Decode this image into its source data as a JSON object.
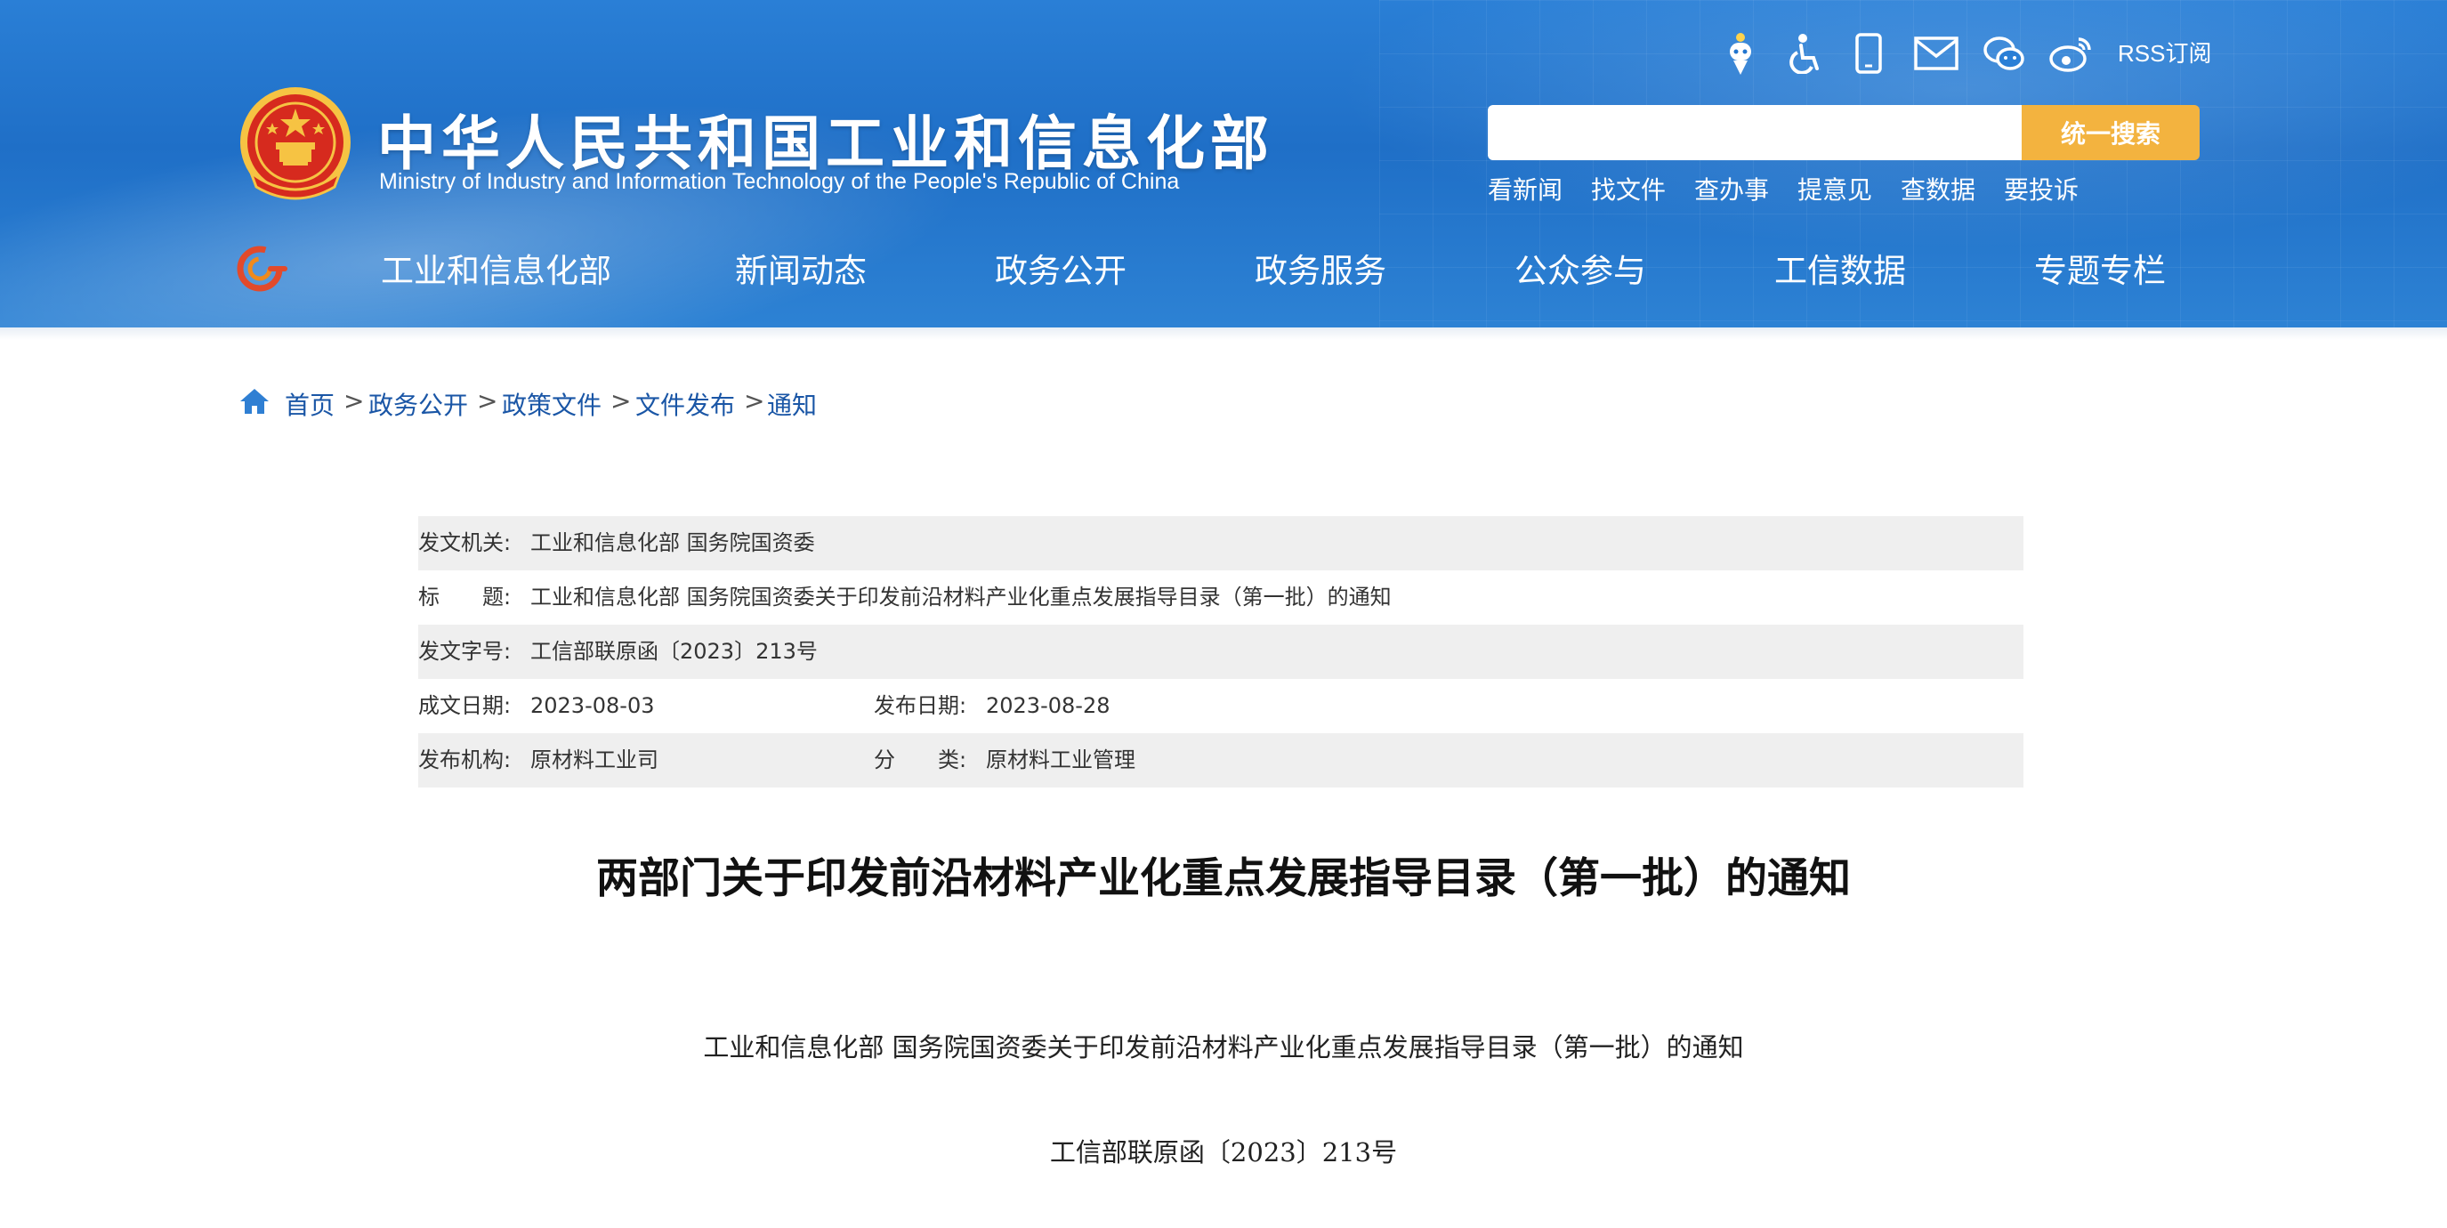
{
  "header": {
    "site_title": "中华人民共和国工业和信息化部",
    "site_subtitle": "Ministry of Industry and Information Technology of the People's Republic of China",
    "top_icons": [
      "ai-assistant-icon",
      "accessibility-icon",
      "mobile-icon",
      "mail-icon",
      "wechat-icon",
      "weibo-icon"
    ],
    "rss_label": "RSS订阅",
    "search": {
      "placeholder": "",
      "button_label": "统一搜索"
    },
    "quick_links": [
      "看新闻",
      "找文件",
      "查办事",
      "提意见",
      "查数据",
      "要投诉"
    ],
    "nav": [
      "工业和信息化部",
      "新闻动态",
      "政务公开",
      "政务服务",
      "公众参与",
      "工信数据",
      "专题专栏"
    ],
    "colors": {
      "header_blue": "#2175cf",
      "search_button": "#f3b33f",
      "emblem_red": "#d62a1e",
      "emblem_gold": "#f6c343"
    }
  },
  "breadcrumb": {
    "items": [
      "首页",
      "政务公开",
      "政策文件",
      "文件发布",
      "通知"
    ],
    "separator": ">"
  },
  "meta": {
    "issuer_label": "发文机关:",
    "issuer_value": "工业和信息化部 国务院国资委",
    "title_label": "标　　题:",
    "title_value": "工业和信息化部 国务院国资委关于印发前沿材料产业化重点发展指导目录（第一批）的通知",
    "docnum_label": "发文字号:",
    "docnum_value": "工信部联原函〔2023〕213号",
    "created_label": "成文日期:",
    "created_value": "2023-08-03",
    "published_label": "发布日期:",
    "published_value": "2023-08-28",
    "org_label": "发布机构:",
    "org_value": "原材料工业司",
    "category_label": "分　　类:",
    "category_value": "原材料工业管理"
  },
  "article": {
    "title": "两部门关于印发前沿材料产业化重点发展指导目录（第一批）的通知",
    "subtitle": "工业和信息化部 国务院国资委关于印发前沿材料产业化重点发展指导目录（第一批）的通知",
    "doc_number": "工信部联原函〔2023〕213号"
  }
}
